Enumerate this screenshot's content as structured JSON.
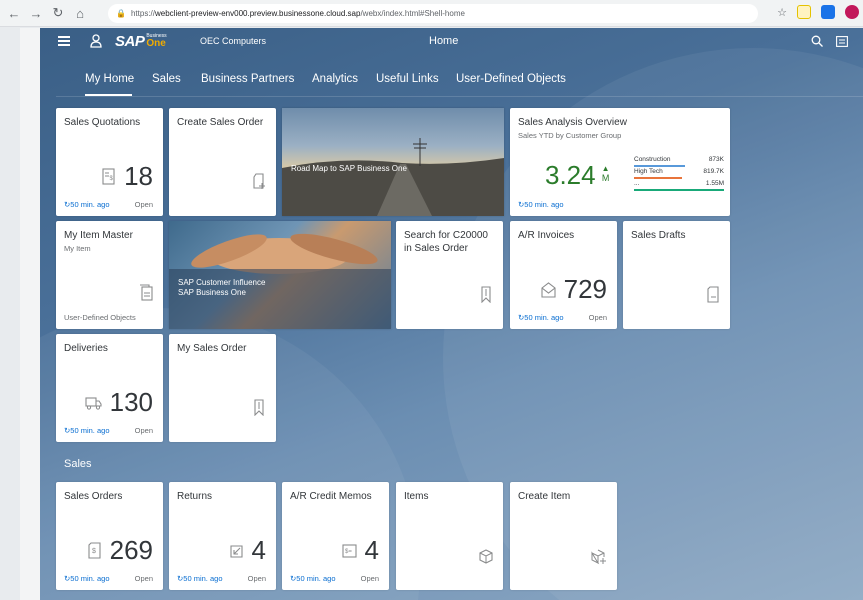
{
  "browser": {
    "url_prefix": "https://",
    "url_host": "webclient-preview-env000.preview.businessone.cloud.sap",
    "url_path": "/webx/index.html#Shell-home"
  },
  "shell": {
    "company": "OEC Computers",
    "title": "Home",
    "logo_text": "SAP",
    "logo_business": "Business",
    "logo_one": "One"
  },
  "tabs": [
    {
      "label": "My Home"
    },
    {
      "label": "Sales"
    },
    {
      "label": "Business Partners"
    },
    {
      "label": "Analytics"
    },
    {
      "label": "Useful Links"
    },
    {
      "label": "User-Defined Objects"
    }
  ],
  "tiles": {
    "sales_quotations": {
      "title": "Sales Quotations",
      "value": "18",
      "refresh": "50 min. ago",
      "status": "Open"
    },
    "create_sales_order": {
      "title": "Create Sales Order"
    },
    "road_map": {
      "caption": "Road Map to SAP Business One"
    },
    "sales_analysis": {
      "title": "Sales Analysis Overview",
      "subtitle": "Sales YTD by Customer Group",
      "value": "3.24",
      "unit": "M",
      "refresh": "50 min. ago"
    },
    "my_item_master": {
      "title": "My Item Master",
      "subtitle": "My Item",
      "footer": "User-Defined Objects"
    },
    "customer_influence": {
      "caption1": "SAP Customer Influence",
      "caption2": "SAP Business One"
    },
    "search_c20000": {
      "title": "Search for C20000 in Sales Order"
    },
    "ar_invoices": {
      "title": "A/R Invoices",
      "value": "729",
      "refresh": "50 min. ago",
      "status": "Open"
    },
    "sales_drafts": {
      "title": "Sales Drafts"
    },
    "deliveries": {
      "title": "Deliveries",
      "value": "130",
      "refresh": "50 min. ago",
      "status": "Open"
    },
    "my_sales_order": {
      "title": "My Sales Order"
    },
    "sales_orders": {
      "title": "Sales Orders",
      "value": "269",
      "refresh": "50 min. ago",
      "status": "Open"
    },
    "returns": {
      "title": "Returns",
      "value": "4",
      "refresh": "50 min. ago",
      "status": "Open"
    },
    "ar_credit_memos": {
      "title": "A/R Credit Memos",
      "value": "4",
      "refresh": "50 min. ago",
      "status": "Open"
    },
    "items": {
      "title": "Items"
    },
    "create_item": {
      "title": "Create Item"
    }
  },
  "group_sales": {
    "label": "Sales"
  },
  "chart_data": {
    "type": "bar",
    "title": "",
    "categories": [
      "Construction",
      "High Tech",
      "..."
    ],
    "series": [
      {
        "values": [
          "873K",
          "819.7K",
          "1.55M"
        ]
      }
    ],
    "colors": [
      "#5899da",
      "#e8743b",
      "#19a979"
    ]
  },
  "colors": {
    "accent": "#0a6ed1",
    "kpi_green": "#2b7c2b",
    "brand_gold": "#f0ab00"
  }
}
